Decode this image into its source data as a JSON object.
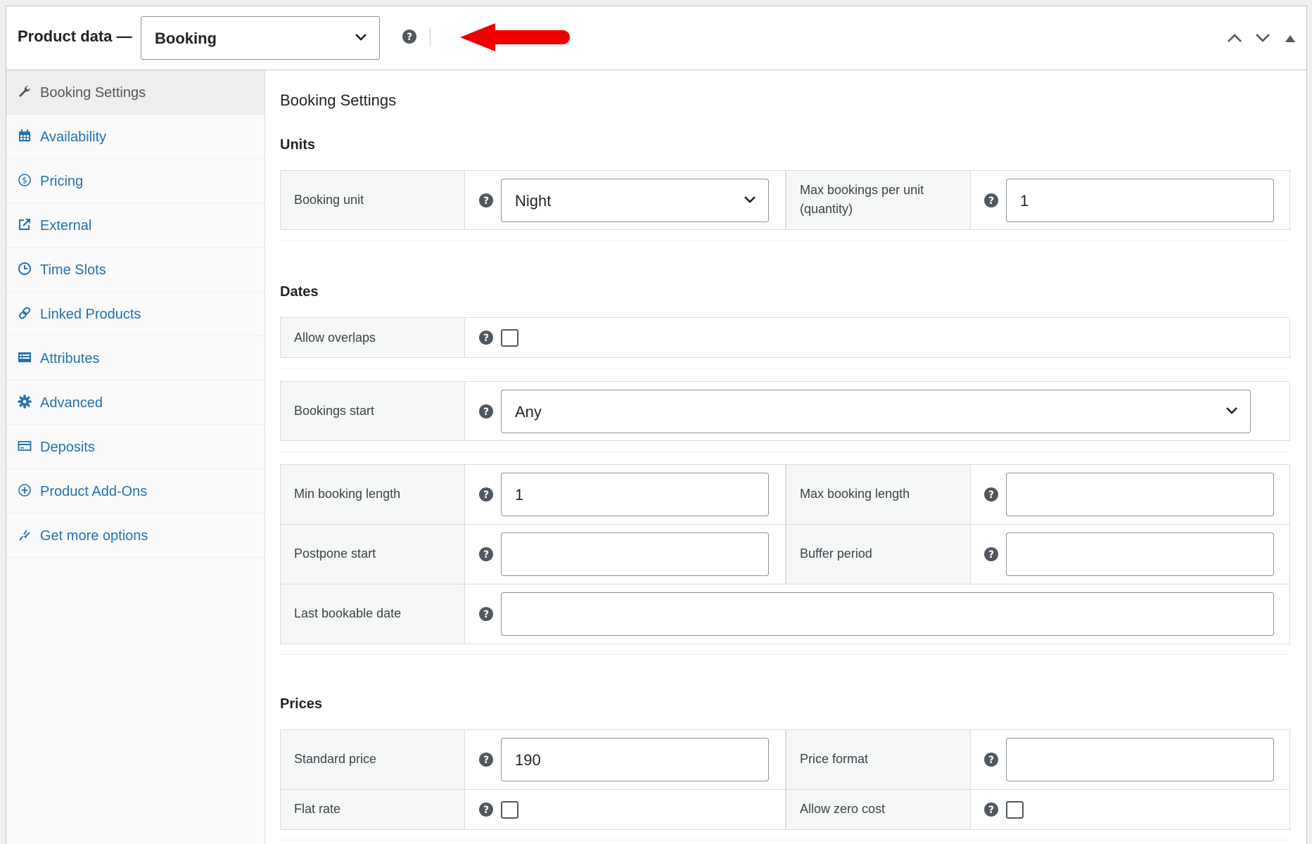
{
  "header": {
    "title": "Product data —",
    "product_type": "Booking"
  },
  "sidebar": {
    "items": [
      {
        "label": "Booking Settings",
        "icon": "wrench-icon",
        "active": true
      },
      {
        "label": "Availability",
        "icon": "calendar-icon"
      },
      {
        "label": "Pricing",
        "icon": "dollar-icon"
      },
      {
        "label": "External",
        "icon": "external-link-icon"
      },
      {
        "label": "Time Slots",
        "icon": "clock-icon"
      },
      {
        "label": "Linked Products",
        "icon": "link-icon"
      },
      {
        "label": "Attributes",
        "icon": "list-icon"
      },
      {
        "label": "Advanced",
        "icon": "gear-icon"
      },
      {
        "label": "Deposits",
        "icon": "card-icon"
      },
      {
        "label": "Product Add-Ons",
        "icon": "plus-circle-icon"
      },
      {
        "label": "Get more options",
        "icon": "plugin-icon"
      }
    ]
  },
  "main": {
    "title": "Booking Settings",
    "units": {
      "heading": "Units",
      "booking_unit_label": "Booking unit",
      "booking_unit_value": "Night",
      "max_bookings_label_1": "Max bookings per unit",
      "max_bookings_label_2": "(quantity)",
      "max_bookings_value": "1"
    },
    "dates": {
      "heading": "Dates",
      "allow_overlaps_label": "Allow overlaps",
      "bookings_start_label": "Bookings start",
      "bookings_start_value": "Any",
      "min_length_label": "Min booking length",
      "min_length_value": "1",
      "max_length_label": "Max booking length",
      "max_length_value": "",
      "postpone_label": "Postpone start",
      "postpone_value": "",
      "buffer_label": "Buffer period",
      "buffer_value": "",
      "last_date_label": "Last bookable date",
      "last_date_value": ""
    },
    "prices": {
      "heading": "Prices",
      "standard_label": "Standard price",
      "standard_value": "190",
      "format_label": "Price format",
      "format_value": "",
      "flat_label": "Flat rate",
      "zero_label": "Allow zero cost"
    }
  },
  "colors": {
    "link": "#2271b1",
    "arrow": "#ee0000",
    "border": "#dcdcde",
    "label_bg": "#f6f7f7"
  }
}
